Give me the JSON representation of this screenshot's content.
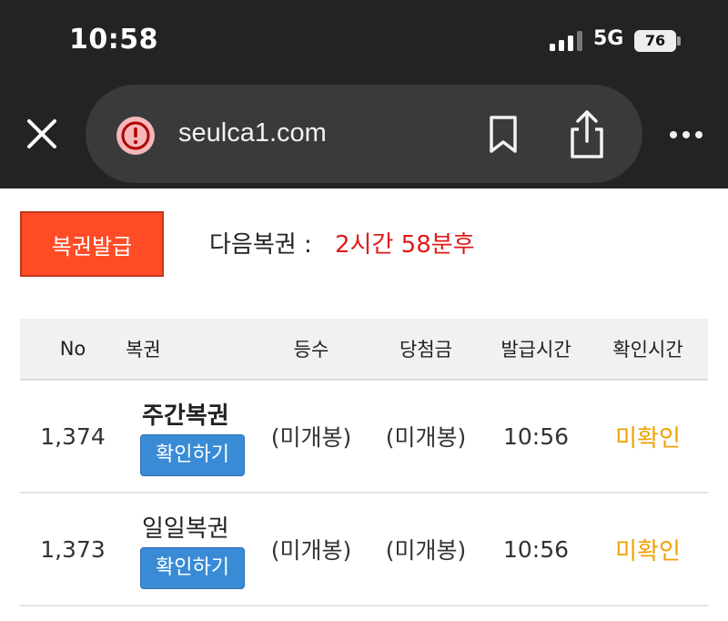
{
  "status_bar": {
    "time": "10:58",
    "network": "5G",
    "battery": "76"
  },
  "browser": {
    "url": "seulca1.com",
    "icons": [
      "close-icon",
      "alert-icon",
      "bookmark-icon",
      "share-icon",
      "more-icon"
    ]
  },
  "page": {
    "issue_button": "복권발급",
    "next_label": "다음복권 :",
    "next_value": "2시간 58분후",
    "colors": {
      "issue": "#ff4b26",
      "countdown": "#e01a1a",
      "confirm_btn": "#3a8bd6",
      "unconfirmed": "#f0a000"
    }
  },
  "table": {
    "headers": [
      "No",
      "복권",
      "등수",
      "당첨금",
      "발급시간",
      "확인시간"
    ],
    "rows": [
      {
        "no": "1,374",
        "ticket": "주간복권",
        "button": "확인하기",
        "rank": "(미개봉)",
        "prize": "(미개봉)",
        "issued": "10:56",
        "checked": "미확인"
      },
      {
        "no": "1,373",
        "ticket": "일일복권",
        "button": "확인하기",
        "rank": "(미개봉)",
        "prize": "(미개봉)",
        "issued": "10:56",
        "checked": "미확인"
      }
    ]
  }
}
